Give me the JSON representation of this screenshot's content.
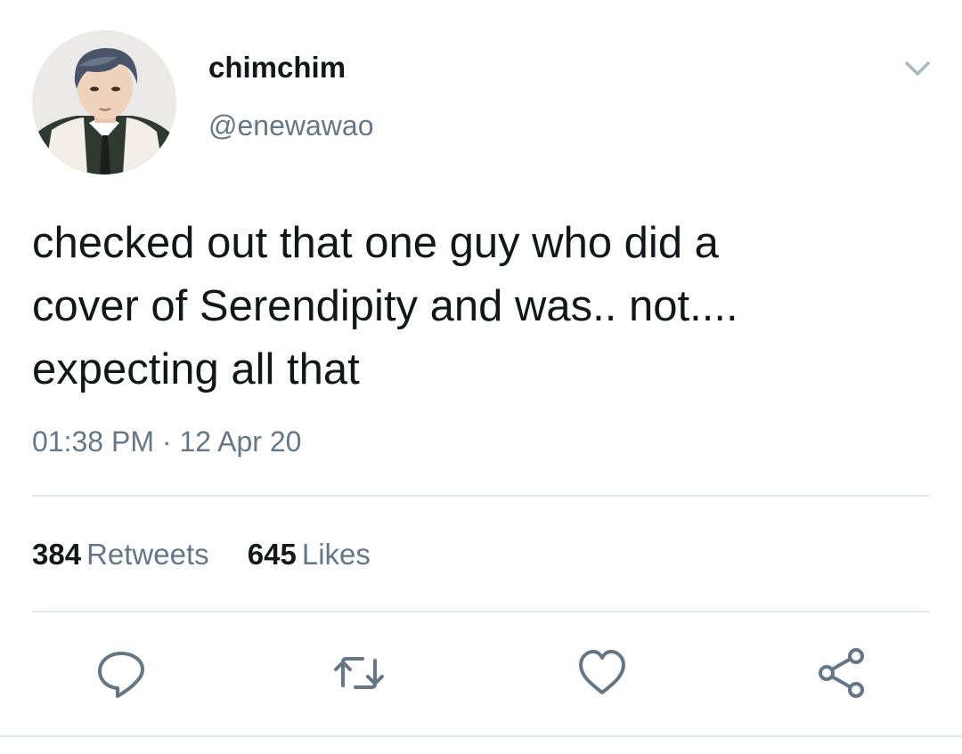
{
  "tweet": {
    "author": {
      "display_name": "chimchim",
      "handle": "@enewawao"
    },
    "text_lines": [
      "checked out that one guy who did a",
      "cover of Serendipity and was.. not....",
      "expecting all that"
    ],
    "time": "01:38 PM",
    "separator": "·",
    "date": "12 Apr 20",
    "stats": {
      "retweets_count": "384",
      "retweets_label": "Retweets",
      "likes_count": "645",
      "likes_label": "Likes"
    },
    "actions": {
      "reply_icon": "reply-icon",
      "retweet_icon": "retweet-icon",
      "like_icon": "heart-icon",
      "share_icon": "share-icon"
    }
  },
  "colors": {
    "primary_text": "#14171a",
    "secondary_text": "#657786",
    "divider": "#e1e8ed"
  }
}
